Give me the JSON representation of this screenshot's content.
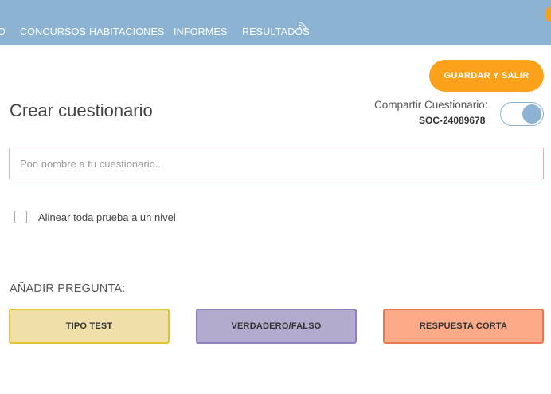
{
  "nav": {
    "items": [
      {
        "label": "O"
      },
      {
        "label": "CONCURSOS"
      },
      {
        "label": "HABITACIONES"
      },
      {
        "label": "INFORMES"
      },
      {
        "label": "RESULTADOS"
      }
    ]
  },
  "header": {
    "save_label": "GUARDAR Y SALIR"
  },
  "page": {
    "title": "Crear cuestionario"
  },
  "share": {
    "label": "Compartir Cuestionario:",
    "code": "SOC-24089678",
    "enabled": true
  },
  "quiz_name": {
    "placeholder": "Pon nombre a tu cuestionario...",
    "value": ""
  },
  "align_checkbox": {
    "label": "Alinear toda prueba a un nivel",
    "checked": false
  },
  "add_question": {
    "title": "AÑADIR PREGUNTA:",
    "buttons": [
      {
        "label": "TIPO TEST",
        "color": "#efdfa9"
      },
      {
        "label": "VERDADERO/FALSO",
        "color": "#b3abcd"
      },
      {
        "label": "RESPUESTA CORTA",
        "color": "#fcaa88"
      }
    ]
  },
  "colors": {
    "nav_bg": "#8db3d2",
    "accent": "#fca11a"
  }
}
